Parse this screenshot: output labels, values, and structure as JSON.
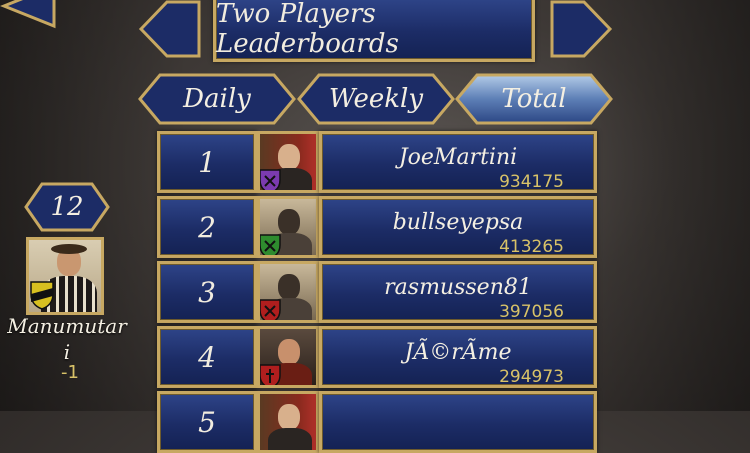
{
  "header": {
    "title": "Two Players Leaderboards"
  },
  "tabs": [
    {
      "label": "Daily",
      "active": false
    },
    {
      "label": "Weekly",
      "active": false
    },
    {
      "label": "Total",
      "active": true
    }
  ],
  "leaderboard": [
    {
      "rank": "1",
      "name": "JoeMartini",
      "score": "934175",
      "shield_color": "#7b3bb0"
    },
    {
      "rank": "2",
      "name": "bullseyepsa",
      "score": "413265",
      "shield_color": "#2e8b2e"
    },
    {
      "rank": "3",
      "name": "rasmussen81",
      "score": "397056",
      "shield_color": "#b01e1e"
    },
    {
      "rank": "4",
      "name": "JÃ©rÃme",
      "score": "294973",
      "shield_color": "#b01e1e"
    },
    {
      "rank": "5",
      "name": "",
      "score": "",
      "shield_color": "#b01e1e"
    }
  ],
  "player": {
    "rank": "12",
    "name_line1": "Manumutar",
    "name_line2": "i",
    "delta": "-1",
    "shield_color": "#d8c020"
  },
  "colors": {
    "gold": "#c7a862",
    "navy": "#1c2c66",
    "score": "#d8c268"
  }
}
